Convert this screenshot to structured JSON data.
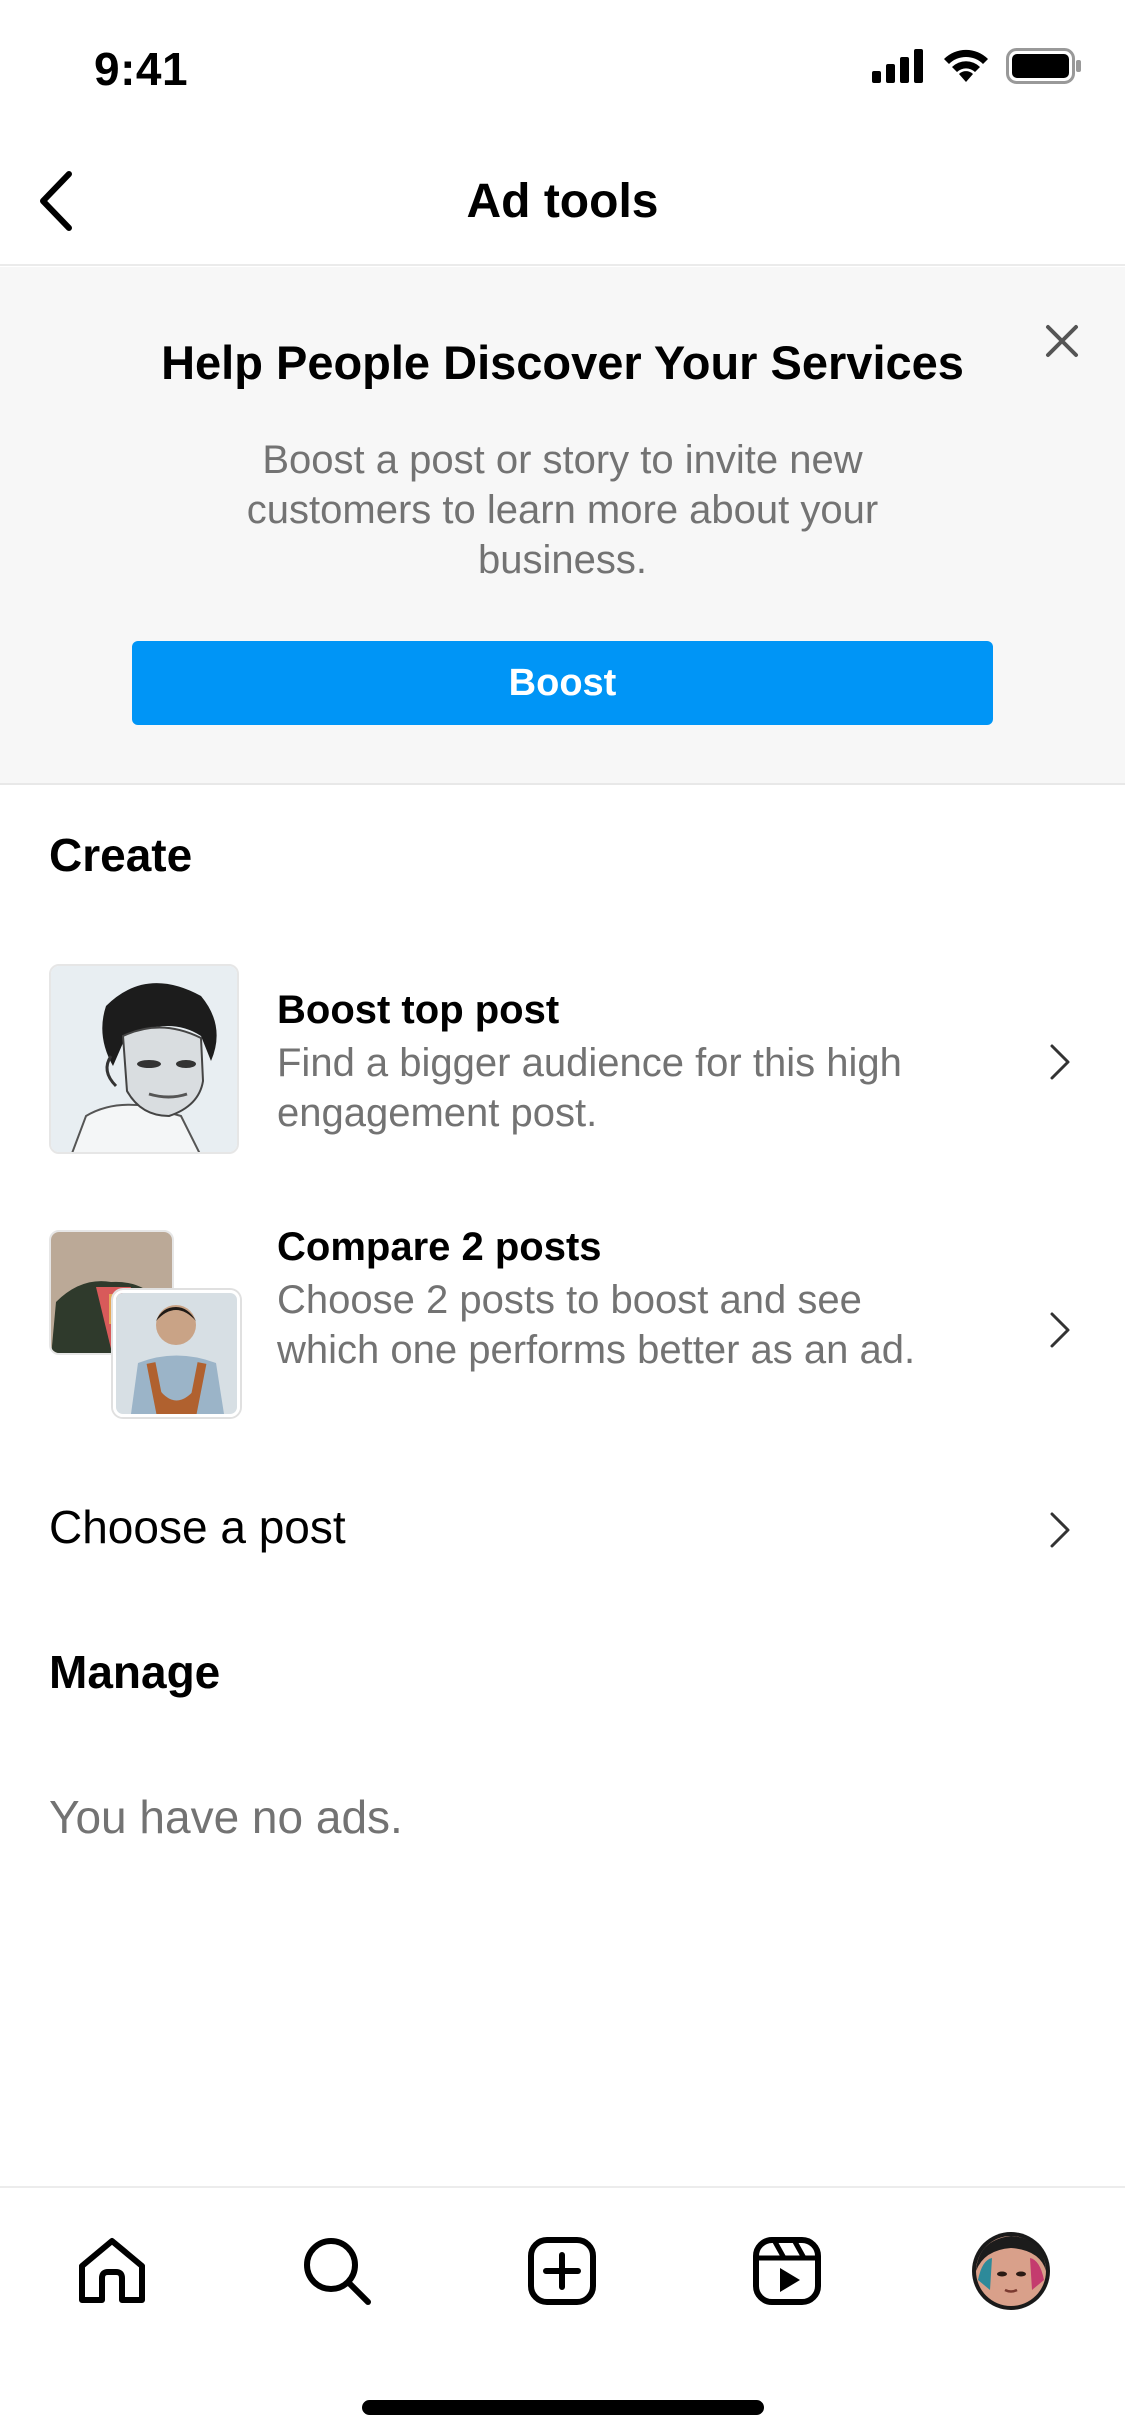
{
  "status_bar": {
    "time": "9:41"
  },
  "header": {
    "title": "Ad tools"
  },
  "promo": {
    "title": "Help People Discover Your Services",
    "text": "Boost a post or story to invite new customers to learn more about your business.",
    "button_label": "Boost"
  },
  "create": {
    "heading": "Create",
    "items": [
      {
        "title": "Boost top post",
        "description": "Find a bigger audience for this high engagement post."
      },
      {
        "title": "Compare 2 posts",
        "description": "Choose 2 posts to boost and see which one performs better as an ad."
      }
    ],
    "choose_label": "Choose a post"
  },
  "manage": {
    "heading": "Manage",
    "empty_text": "You have no ads."
  },
  "tab_bar": {
    "tabs": [
      {
        "icon": "home-icon"
      },
      {
        "icon": "search-icon"
      },
      {
        "icon": "create-plus-icon"
      },
      {
        "icon": "reels-icon"
      },
      {
        "icon": "profile-avatar"
      }
    ]
  },
  "colors": {
    "accent": "#0095f6",
    "secondary_text": "#737373",
    "banner_bg": "#f7f7f7"
  }
}
